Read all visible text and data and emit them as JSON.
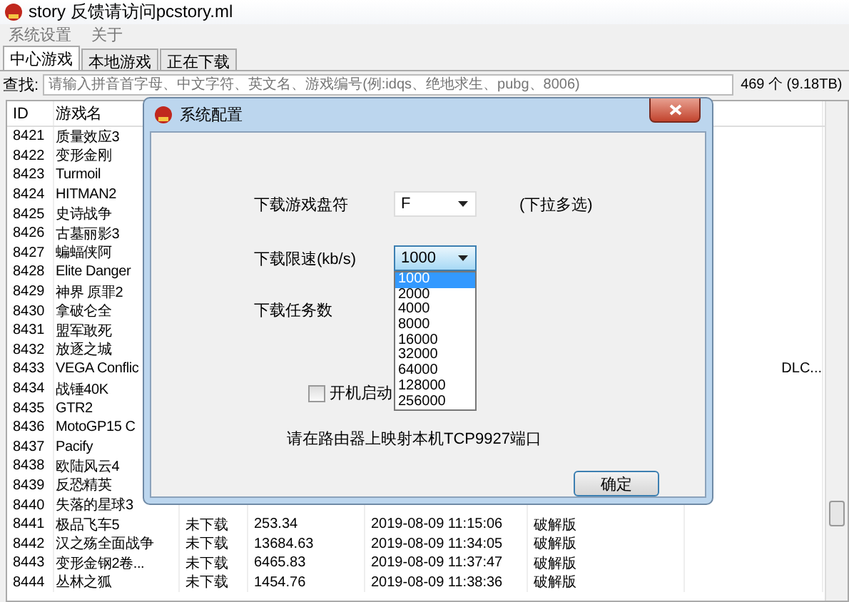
{
  "window": {
    "title": "story 反馈请访问pcstory.ml"
  },
  "menu": [
    "系统设置",
    "关于"
  ],
  "tabs": [
    {
      "label": "中心游戏",
      "selected": true
    },
    {
      "label": "本地游戏",
      "selected": false
    },
    {
      "label": "正在下载",
      "selected": false
    }
  ],
  "search": {
    "label": "查找:",
    "placeholder": "请输入拼音首字母、中文字符、英文名、游戏编号(例:idqs、绝地求生、pubg、8006)",
    "count": "469 个 (9.18TB)"
  },
  "table": {
    "columns": [
      "ID",
      "游戏名"
    ],
    "rows": [
      {
        "id": "8421",
        "name": "质量效应3"
      },
      {
        "id": "8422",
        "name": "变形金刚"
      },
      {
        "id": "8423",
        "name": "Turmoil"
      },
      {
        "id": "8424",
        "name": "HITMAN2"
      },
      {
        "id": "8425",
        "name": "史诗战争"
      },
      {
        "id": "8426",
        "name": "古墓丽影3"
      },
      {
        "id": "8427",
        "name": "蝙蝠侠阿"
      },
      {
        "id": "8428",
        "name": "Elite Danger"
      },
      {
        "id": "8429",
        "name": "神界 原罪2"
      },
      {
        "id": "8430",
        "name": "拿破仑全"
      },
      {
        "id": "8431",
        "name": "盟军敢死"
      },
      {
        "id": "8432",
        "name": "放逐之城"
      },
      {
        "id": "8433",
        "name": "VEGA Conflic",
        "column_7": "DLC..."
      },
      {
        "id": "8434",
        "name": "战锤40K"
      },
      {
        "id": "8435",
        "name": "GTR2"
      },
      {
        "id": "8436",
        "name": "MotoGP15 C"
      },
      {
        "id": "8437",
        "name": "Pacify"
      },
      {
        "id": "8438",
        "name": "欧陆风云4"
      },
      {
        "id": "8439",
        "name": "反恐精英"
      },
      {
        "id": "8440",
        "name": "失落的星球3"
      },
      {
        "id": "8441",
        "name": "极品飞车5",
        "status": "未下载",
        "size": "253.34",
        "date": "2019-08-09 11:15:06",
        "type": "破解版"
      },
      {
        "id": "8442",
        "name": "汉之殇全面战争",
        "status": "未下载",
        "size": "13684.63",
        "date": "2019-08-09 11:34:05",
        "type": "破解版"
      },
      {
        "id": "8443",
        "name": "变形金钢2卷...",
        "status": "未下载",
        "size": "6465.83",
        "date": "2019-08-09 11:37:47",
        "type": "破解版"
      },
      {
        "id": "8444",
        "name": "丛林之狐",
        "status": "未下载",
        "size": "1454.76",
        "date": "2019-08-09 11:38:36",
        "type": "破解版"
      }
    ]
  },
  "dialog": {
    "title": "系统配置",
    "drive": {
      "label": "下载游戏盘符",
      "value": "F",
      "hint": "(下拉多选)"
    },
    "speed": {
      "label": "下载限速(kb/s)",
      "value": "1000",
      "expanded": true,
      "options": [
        {
          "label": "1000",
          "selected": true
        },
        {
          "label": "2000",
          "selected": false
        },
        {
          "label": "4000",
          "selected": false
        },
        {
          "label": "8000",
          "selected": false
        },
        {
          "label": "16000",
          "selected": false
        },
        {
          "label": "32000",
          "selected": false
        },
        {
          "label": "64000",
          "selected": false
        },
        {
          "label": "128000",
          "selected": false
        },
        {
          "label": "256000",
          "selected": false
        }
      ]
    },
    "tasks": {
      "label": "下载任务数"
    },
    "autostart": {
      "label": "开机启动",
      "checked": false
    },
    "note": "请在路由器上映射本机TCP9927端口",
    "ok": "确定"
  }
}
